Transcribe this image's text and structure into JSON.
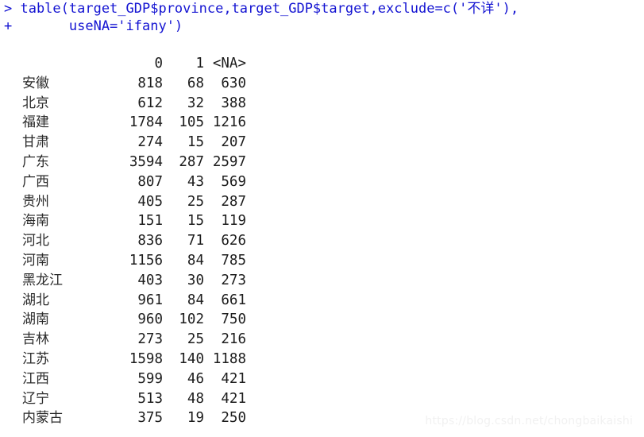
{
  "console": {
    "prompt_symbol": ">",
    "continuation_symbol": "+",
    "command_lines": [
      "> table(target_GDP$province,target_GDP$target,exclude=c('不详'),",
      "+       useNA='ifany')"
    ],
    "text_color": "#1414d2",
    "output_color": "#1c1c1c",
    "background_color": "#ffffff"
  },
  "table": {
    "headers": [
      "",
      "0",
      "1",
      "<NA>"
    ],
    "col_0_label": "0",
    "col_1_label": "1",
    "col_na_label": "<NA>",
    "rows": [
      {
        "name": "安徽",
        "c0": "818",
        "c1": "68",
        "na": "630"
      },
      {
        "name": "北京",
        "c0": "612",
        "c1": "32",
        "na": "388"
      },
      {
        "name": "福建",
        "c0": "1784",
        "c1": "105",
        "na": "1216"
      },
      {
        "name": "甘肃",
        "c0": "274",
        "c1": "15",
        "na": "207"
      },
      {
        "name": "广东",
        "c0": "3594",
        "c1": "287",
        "na": "2597"
      },
      {
        "name": "广西",
        "c0": "807",
        "c1": "43",
        "na": "569"
      },
      {
        "name": "贵州",
        "c0": "405",
        "c1": "25",
        "na": "287"
      },
      {
        "name": "海南",
        "c0": "151",
        "c1": "15",
        "na": "119"
      },
      {
        "name": "河北",
        "c0": "836",
        "c1": "71",
        "na": "626"
      },
      {
        "name": "河南",
        "c0": "1156",
        "c1": "84",
        "na": "785"
      },
      {
        "name": "黑龙江",
        "c0": "403",
        "c1": "30",
        "na": "273"
      },
      {
        "name": "湖北",
        "c0": "961",
        "c1": "84",
        "na": "661"
      },
      {
        "name": "湖南",
        "c0": "960",
        "c1": "102",
        "na": "750"
      },
      {
        "name": "吉林",
        "c0": "273",
        "c1": "25",
        "na": "216"
      },
      {
        "name": "江苏",
        "c0": "1598",
        "c1": "140",
        "na": "1188"
      },
      {
        "name": "江西",
        "c0": "599",
        "c1": "46",
        "na": "421"
      },
      {
        "name": "辽宁",
        "c0": "513",
        "c1": "48",
        "na": "421"
      },
      {
        "name": "内蒙古",
        "c0": "375",
        "c1": "19",
        "na": "250"
      }
    ]
  },
  "watermark": {
    "text": "https://blog.csdn.net/chongbaikaishi",
    "color": "#f1f1f1"
  }
}
